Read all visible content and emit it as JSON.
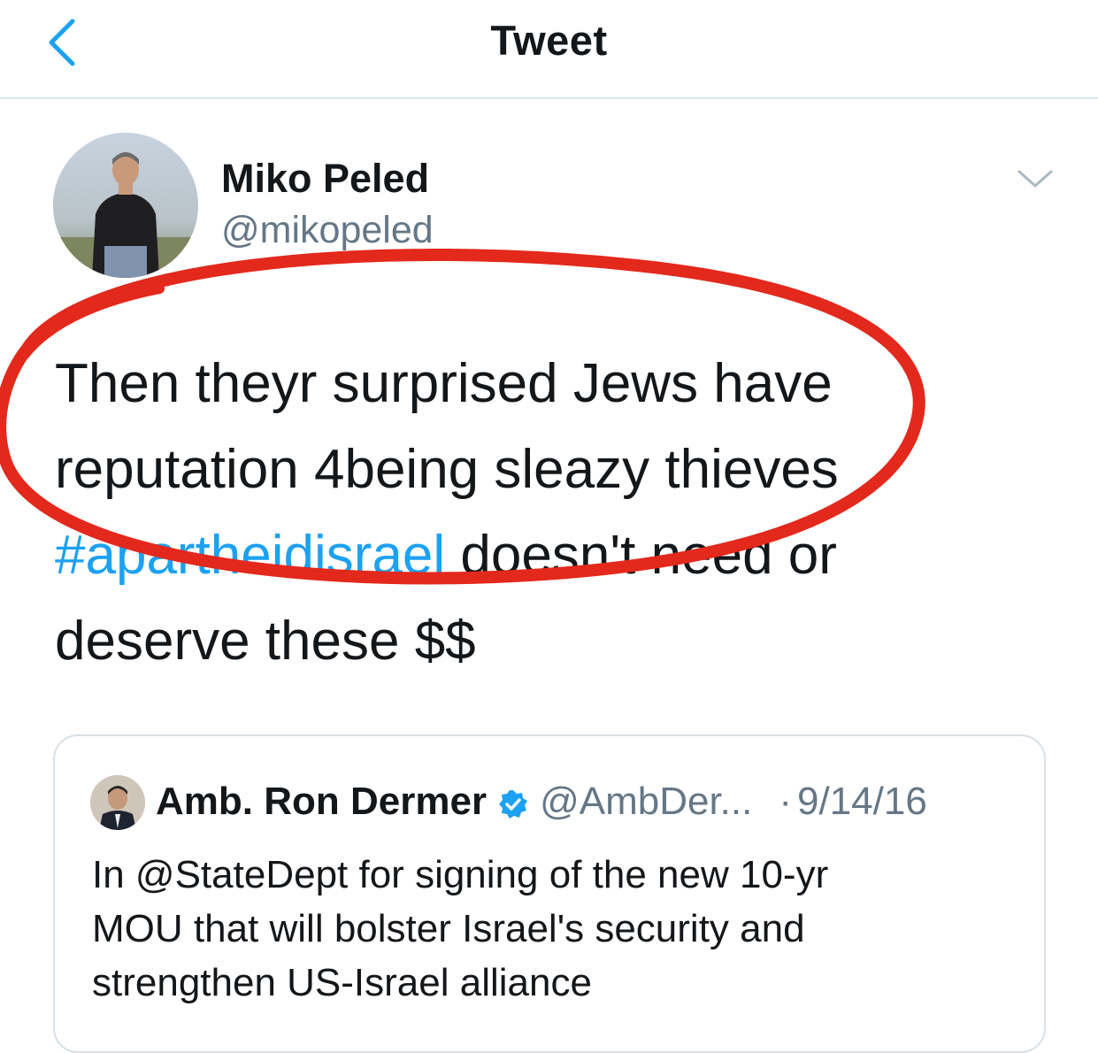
{
  "header": {
    "title": "Tweet",
    "back_icon": "chevron-left-icon"
  },
  "author": {
    "name": "Miko Peled",
    "handle": "@mikopeled",
    "more_icon": "chevron-down-icon"
  },
  "tweet": {
    "lines": [
      "Then theyr surprised Jews have",
      "reputation 4being sleazy thieves"
    ],
    "hashtag": "#apartheidisrael",
    "line3_rest": " doesn't need or",
    "line4": "deserve these $$"
  },
  "quoted_tweet": {
    "name": "Amb. Ron Dermer",
    "handle": "@AmbDer...",
    "separator": "·",
    "date": "9/14/16",
    "verified_icon": "verified-badge-icon",
    "lines": [
      "In @StateDept for signing of the new 10-yr",
      "MOU that will bolster Israel's security and",
      "strengthen US-Israel alliance"
    ]
  },
  "colors": {
    "link_blue": "#1da1f2",
    "secondary_text": "#657786",
    "annotation_red": "#e3281c",
    "divider": "#e1e8ed"
  }
}
